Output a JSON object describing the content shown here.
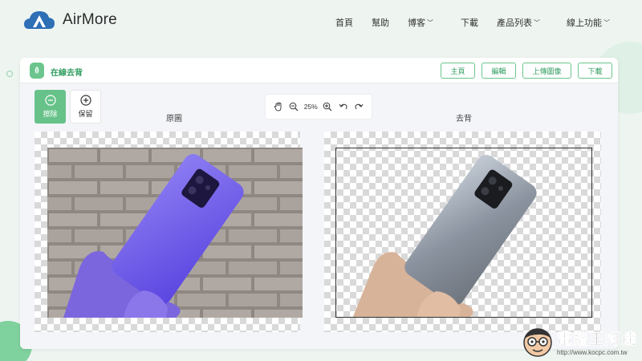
{
  "brand": {
    "name": "AirMore",
    "accent": "#2e6fb6"
  },
  "nav": {
    "items": [
      {
        "label": "首頁",
        "dropdown": false
      },
      {
        "label": "幫助",
        "dropdown": false
      },
      {
        "label": "博客",
        "dropdown": true
      },
      {
        "label": "下載",
        "dropdown": false
      },
      {
        "label": "產品列表",
        "dropdown": true
      },
      {
        "label": "線上功能",
        "dropdown": true
      }
    ]
  },
  "tool": {
    "title": "在線去背",
    "accent": "#67c28a",
    "header_buttons": [
      "主頁",
      "編輯",
      "上傳圖像",
      "下載"
    ]
  },
  "modes": {
    "erase": "擦除",
    "keep": "保留",
    "active": "erase"
  },
  "toolbar": {
    "zoom": "25%",
    "icons": [
      "hand-icon",
      "zoom-out-icon",
      "zoom-in-icon",
      "undo-icon",
      "redo-icon"
    ]
  },
  "panes": {
    "original_title": "原圖",
    "result_title": "去背"
  },
  "watermark": {
    "title": "電腦王阿達",
    "url": "http://www.kocpc.com.tw"
  }
}
